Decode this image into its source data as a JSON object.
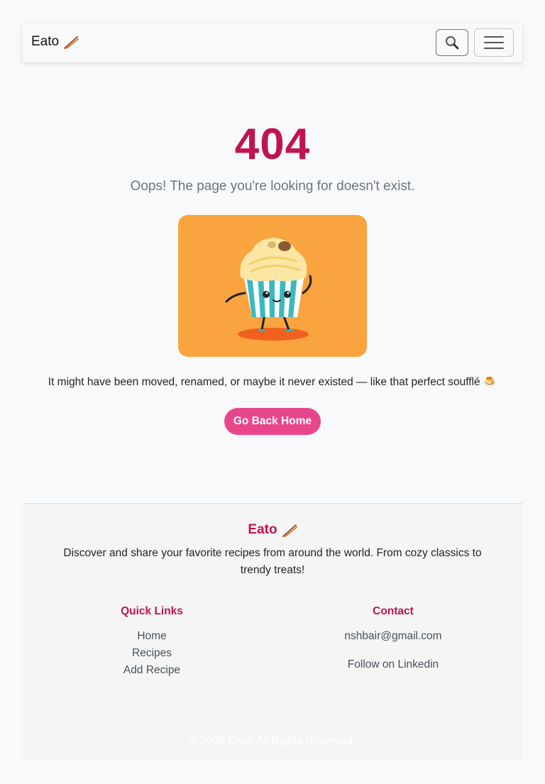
{
  "navbar": {
    "brand": "Eato",
    "brand_icon": "chopsticks-icon",
    "search_icon": "search-icon",
    "toggler_icon": "hamburger-menu-icon"
  },
  "error": {
    "code": "404",
    "message": "Oops! The page you're looking for doesn't exist.",
    "description": "It might have been moved, renamed, or maybe it never existed — like that perfect soufflé 🍮",
    "button_label": "Go Back Home",
    "illustration": "dancing-cupcake-illustration"
  },
  "footer": {
    "brand": "Eato",
    "description": "Discover and share your favorite recipes from around the world. From cozy classics to trendy treats!",
    "quick_links_title": "Quick Links",
    "quick_links": [
      "Home",
      "Recipes",
      "Add Recipe"
    ],
    "contact_title": "Contact",
    "email": "nshbair@gmail.com",
    "linkedin": "Follow on Linkedin",
    "copyright": "© 2025 Eato. All Rights Reserved."
  },
  "colors": {
    "accent": "#c0144f",
    "button": "#e8468a",
    "illustration_bg": "#f9a43f"
  }
}
